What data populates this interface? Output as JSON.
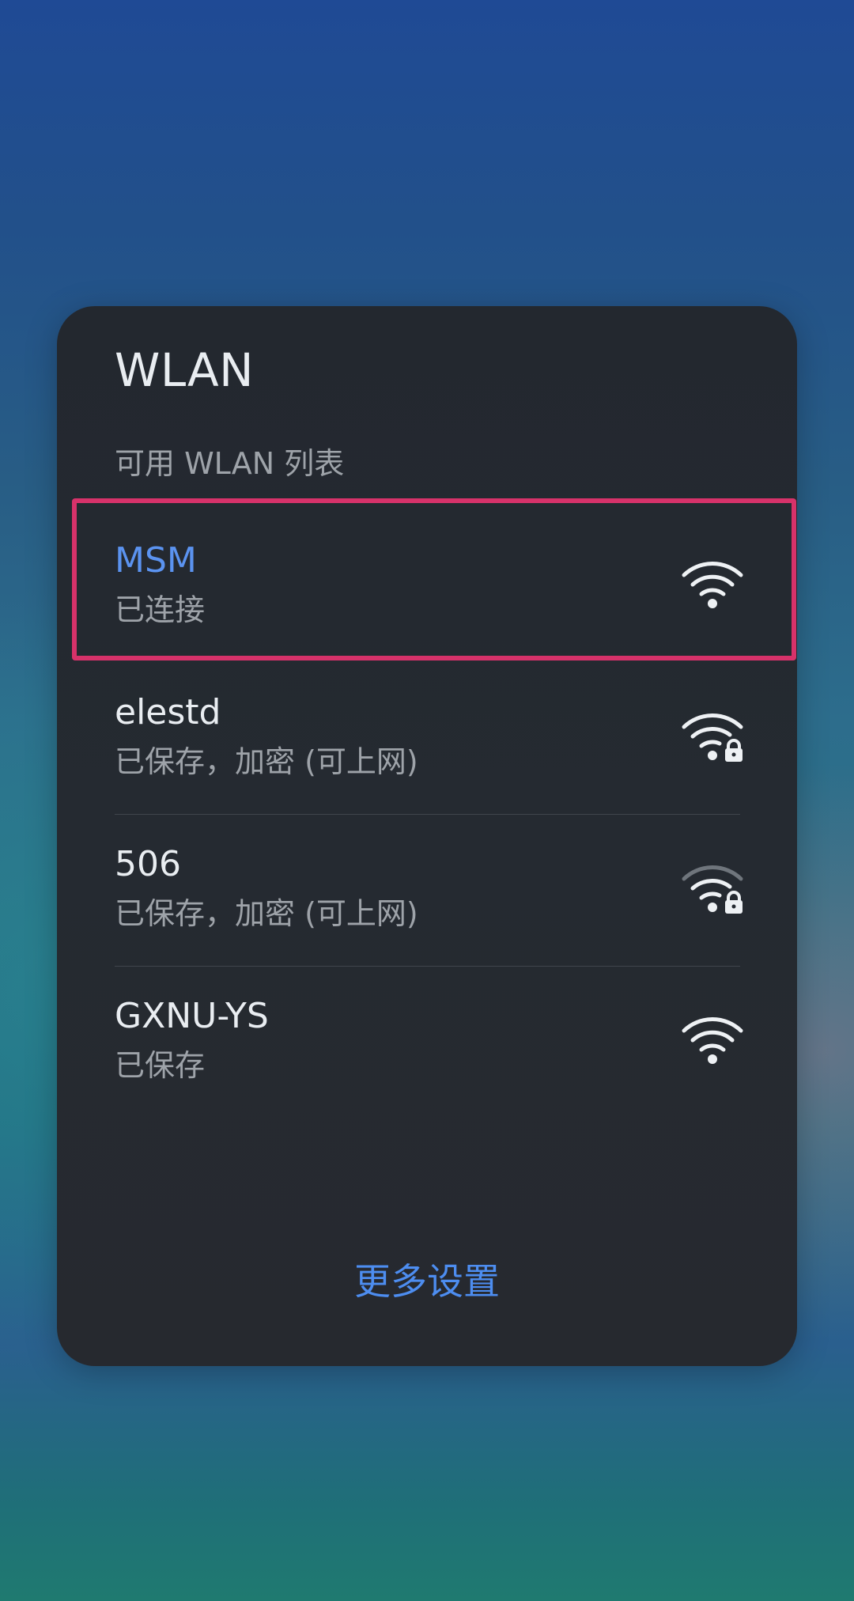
{
  "dialog": {
    "title": "WLAN",
    "subtitle": "可用 WLAN 列表",
    "more_settings_label": "更多设置"
  },
  "networks": [
    {
      "name": "MSM",
      "status": "已连接",
      "icon": "wifi-icon",
      "locked": false,
      "connected": true,
      "name_color": "#5b93f0"
    },
    {
      "name": "elestd",
      "status": "已保存，加密 (可上网)",
      "icon": "wifi-lock-icon",
      "locked": true,
      "connected": false
    },
    {
      "name": "506",
      "status": "已保存，加密 (可上网)",
      "icon": "wifi-lock-icon",
      "locked": true,
      "connected": false
    },
    {
      "name": "GXNU-YS",
      "status": "已保存",
      "icon": "wifi-icon",
      "locked": false,
      "connected": false
    }
  ],
  "colors": {
    "accent": "#4d8df0",
    "highlight_border": "#d7326a",
    "panel_background": "#252a31"
  }
}
